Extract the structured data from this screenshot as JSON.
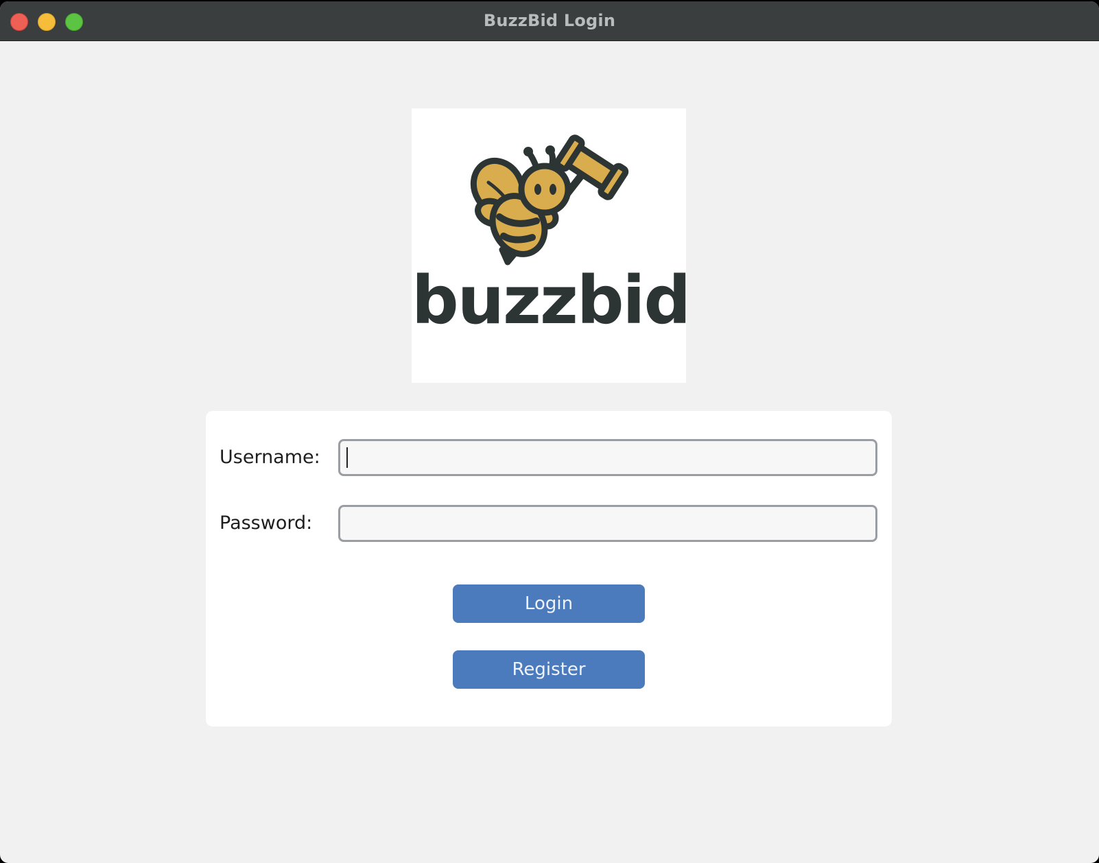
{
  "window": {
    "title": "BuzzBid Login"
  },
  "logo": {
    "text": "buzzbid",
    "icon": "bee-with-gavel-icon",
    "colors": {
      "gold": "#d9ad4d",
      "dark": "#2c3434"
    }
  },
  "form": {
    "username_label": "Username:",
    "username_value": "",
    "password_label": "Password:",
    "password_value": ""
  },
  "buttons": {
    "login_label": "Login",
    "register_label": "Register"
  },
  "colors": {
    "button_blue": "#4b7bbd",
    "titlebar": "#3a3e3f",
    "window_bg": "#f1f1f1"
  }
}
